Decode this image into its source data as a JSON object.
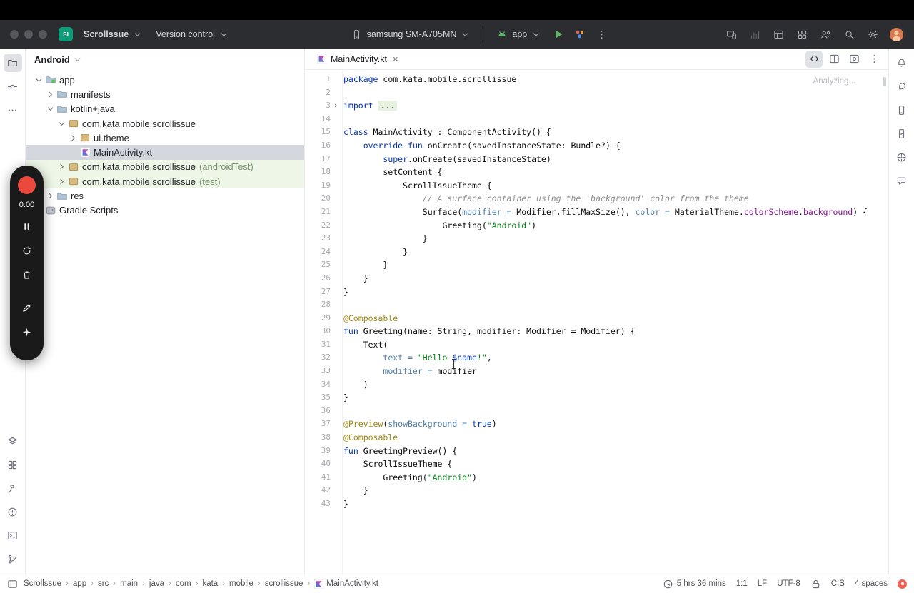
{
  "toolbar": {
    "logo_text": "SI",
    "project_name": "Scrollssue",
    "vcs_label": "Version control",
    "device_label": "samsung SM-A705MN",
    "run_config_label": "app",
    "right_icons": [
      {
        "name": "mirror-device-icon",
        "glyph": "mirror"
      },
      {
        "name": "profiler-icon",
        "glyph": "profiler",
        "dim": true
      },
      {
        "name": "tool-windows-icon",
        "glyph": "toolwin"
      },
      {
        "name": "plugins-icon",
        "glyph": "plugins"
      },
      {
        "name": "code-with-me-icon",
        "glyph": "cwm"
      },
      {
        "name": "search-icon",
        "glyph": "search"
      },
      {
        "name": "settings-icon",
        "glyph": "gear"
      },
      {
        "name": "user-avatar",
        "glyph": "avatar"
      }
    ]
  },
  "left_stripe": {
    "top": [
      {
        "name": "project-icon",
        "glyph": "folder",
        "active": true
      },
      {
        "name": "commit-icon",
        "glyph": "commit"
      },
      {
        "name": "more-tool-windows-icon",
        "glyph": "dots"
      }
    ],
    "bottom": [
      {
        "name": "build-variants-icon",
        "glyph": "layers"
      },
      {
        "name": "resource-manager-icon",
        "glyph": "plugins"
      },
      {
        "name": "build-icon",
        "glyph": "build"
      },
      {
        "name": "problems-icon",
        "glyph": "alert"
      },
      {
        "name": "terminal-icon",
        "glyph": "terminal"
      },
      {
        "name": "version-control-icon",
        "glyph": "branch"
      }
    ]
  },
  "right_stripe": {
    "top": [
      {
        "name": "notifications-icon",
        "glyph": "bell"
      },
      {
        "name": "gradle-icon",
        "glyph": "gradle"
      },
      {
        "name": "device-manager-icon",
        "glyph": "phone"
      },
      {
        "name": "running-devices-icon",
        "glyph": "device2"
      },
      {
        "name": "app-quality-insights-icon",
        "glyph": "insights"
      },
      {
        "name": "assistant-icon",
        "glyph": "assistant"
      }
    ]
  },
  "project": {
    "view_selector": "Android",
    "tree": [
      {
        "label": "app",
        "depth": 0,
        "chevron": "open",
        "icon": "module"
      },
      {
        "label": "manifests",
        "depth": 1,
        "chevron": "closed",
        "icon": "folder"
      },
      {
        "label": "kotlin+java",
        "depth": 1,
        "chevron": "open",
        "icon": "folder"
      },
      {
        "label": "com.kata.mobile.scrollissue",
        "depth": 2,
        "chevron": "open",
        "icon": "package"
      },
      {
        "label": "ui.theme",
        "depth": 3,
        "chevron": "closed",
        "icon": "package"
      },
      {
        "label": "MainActivity.kt",
        "depth": 3,
        "chevron": null,
        "icon": "kotlin",
        "state": "selected"
      },
      {
        "label": "com.kata.mobile.scrollissue",
        "suffix": "(androidTest)",
        "depth": 2,
        "chevron": "closed",
        "icon": "package",
        "state": "green"
      },
      {
        "label": "com.kata.mobile.scrollissue",
        "suffix": "(test)",
        "depth": 2,
        "chevron": "closed",
        "icon": "package",
        "state": "green"
      },
      {
        "label": "res",
        "depth": 1,
        "chevron": "closed",
        "icon": "folder"
      },
      {
        "label": "Gradle Scripts",
        "depth": 0,
        "chevron": "closed",
        "icon": "gradle"
      }
    ]
  },
  "editor": {
    "tab_label": "MainActivity.kt",
    "analyzing": "Analyzing...",
    "mode_icons": [
      {
        "name": "editor-mode-code-icon",
        "glyph": "codeview",
        "active": true
      },
      {
        "name": "editor-mode-split-icon",
        "glyph": "splitview"
      },
      {
        "name": "editor-mode-design-icon",
        "glyph": "designview"
      }
    ],
    "lines": [
      {
        "n": 1,
        "s": [
          [
            "kw",
            "package "
          ],
          [
            "p",
            "com.kata.mobile.scrollissue"
          ]
        ]
      },
      {
        "n": 2,
        "s": []
      },
      {
        "n": 3,
        "fold": true,
        "s": [
          [
            "kw",
            "import "
          ],
          [
            "fold",
            "..."
          ]
        ]
      },
      {
        "n": 14,
        "s": []
      },
      {
        "n": 15,
        "s": [
          [
            "kw",
            "class "
          ],
          [
            "p",
            "MainActivity : ComponentActivity() {"
          ]
        ]
      },
      {
        "n": 16,
        "s": [
          [
            "p",
            "    "
          ],
          [
            "kw",
            "override fun "
          ],
          [
            "p",
            "onCreate(savedInstanceState: Bundle?) {"
          ]
        ]
      },
      {
        "n": 17,
        "s": [
          [
            "p",
            "        "
          ],
          [
            "kw",
            "super"
          ],
          [
            "p",
            ".onCreate(savedInstanceState)"
          ]
        ]
      },
      {
        "n": 18,
        "s": [
          [
            "p",
            "        setContent {"
          ]
        ]
      },
      {
        "n": 19,
        "s": [
          [
            "p",
            "            ScrollIssueTheme {"
          ]
        ]
      },
      {
        "n": 20,
        "s": [
          [
            "p",
            "                "
          ],
          [
            "cm",
            "// A surface container using the 'background' color from the theme"
          ]
        ]
      },
      {
        "n": 21,
        "s": [
          [
            "p",
            "                Surface("
          ],
          [
            "na",
            "modifier = "
          ],
          [
            "p",
            "Modifier.fillMaxSize(), "
          ],
          [
            "na",
            "color = "
          ],
          [
            "p",
            "MaterialTheme."
          ],
          [
            "pr",
            "colorScheme"
          ],
          [
            "p",
            "."
          ],
          [
            "pr",
            "background"
          ],
          [
            "p",
            ") {"
          ]
        ]
      },
      {
        "n": 22,
        "s": [
          [
            "p",
            "                    Greeting("
          ],
          [
            "str",
            "\"Android\""
          ],
          [
            "p",
            ")"
          ]
        ]
      },
      {
        "n": 23,
        "s": [
          [
            "p",
            "                }"
          ]
        ]
      },
      {
        "n": 24,
        "s": [
          [
            "p",
            "            }"
          ]
        ]
      },
      {
        "n": 25,
        "s": [
          [
            "p",
            "        }"
          ]
        ]
      },
      {
        "n": 26,
        "s": [
          [
            "p",
            "    }"
          ]
        ]
      },
      {
        "n": 27,
        "s": [
          [
            "p",
            "}"
          ]
        ]
      },
      {
        "n": 28,
        "s": []
      },
      {
        "n": 29,
        "s": [
          [
            "ann",
            "@Composable"
          ]
        ]
      },
      {
        "n": 30,
        "s": [
          [
            "kw",
            "fun "
          ],
          [
            "p",
            "Greeting(name: String, modifier: Modifier = Modifier) {"
          ]
        ]
      },
      {
        "n": 31,
        "s": [
          [
            "p",
            "    Text("
          ]
        ]
      },
      {
        "n": 32,
        "s": [
          [
            "p",
            "        "
          ],
          [
            "na",
            "text = "
          ],
          [
            "str",
            "\"Hello "
          ],
          [
            "kw",
            "$name"
          ],
          [
            "str",
            "!\""
          ],
          [
            "p",
            ","
          ]
        ]
      },
      {
        "n": 33,
        "s": [
          [
            "p",
            "        "
          ],
          [
            "na",
            "modifier = "
          ],
          [
            "p",
            "modifier"
          ]
        ]
      },
      {
        "n": 34,
        "s": [
          [
            "p",
            "    )"
          ]
        ]
      },
      {
        "n": 35,
        "s": [
          [
            "p",
            "}"
          ]
        ]
      },
      {
        "n": 36,
        "s": []
      },
      {
        "n": 37,
        "s": [
          [
            "ann",
            "@Preview"
          ],
          [
            "p",
            "("
          ],
          [
            "na",
            "showBackground = "
          ],
          [
            "kw",
            "true"
          ],
          [
            "p",
            ")"
          ]
        ]
      },
      {
        "n": 38,
        "s": [
          [
            "ann",
            "@Composable"
          ]
        ]
      },
      {
        "n": 39,
        "s": [
          [
            "kw",
            "fun "
          ],
          [
            "p",
            "GreetingPreview() {"
          ]
        ]
      },
      {
        "n": 40,
        "s": [
          [
            "p",
            "    ScrollIssueTheme {"
          ]
        ]
      },
      {
        "n": 41,
        "s": [
          [
            "p",
            "        Greeting("
          ],
          [
            "str",
            "\"Android\""
          ],
          [
            "p",
            ")"
          ]
        ]
      },
      {
        "n": 42,
        "s": [
          [
            "p",
            "    }"
          ]
        ]
      },
      {
        "n": 43,
        "s": [
          [
            "p",
            "}"
          ]
        ]
      }
    ]
  },
  "record_widget": {
    "time": "0:00",
    "buttons": [
      {
        "name": "pause-button",
        "glyph": "pause"
      },
      {
        "name": "restart-button",
        "glyph": "restart"
      },
      {
        "name": "delete-button",
        "glyph": "trash"
      },
      {
        "name": "annotate-button",
        "glyph": "pencil",
        "gap": true
      },
      {
        "name": "ai-actions-button",
        "glyph": "sparkle"
      }
    ]
  },
  "statusbar": {
    "breadcrumbs": [
      {
        "label": "Scrollssue"
      },
      {
        "label": "app"
      },
      {
        "label": "src"
      },
      {
        "label": "main"
      },
      {
        "label": "java"
      },
      {
        "label": "com"
      },
      {
        "label": "kata"
      },
      {
        "label": "mobile"
      },
      {
        "label": "scrollissue"
      },
      {
        "label": "MainActivity.kt",
        "icon": "kotlin"
      }
    ],
    "right_items": [
      {
        "name": "session-timer",
        "icon": "clock",
        "label": "5 hrs 36 mins"
      },
      {
        "name": "cursor-position",
        "label": "1:1"
      },
      {
        "name": "line-separator",
        "label": "LF"
      },
      {
        "name": "file-encoding",
        "label": "UTF-8"
      },
      {
        "name": "read-only-toggle",
        "icon": "lock",
        "label": ""
      },
      {
        "name": "column-selection-mode",
        "label": "C:S"
      },
      {
        "name": "indent-style",
        "label": "4 spaces"
      },
      {
        "name": "notification-badge",
        "icon": "badge",
        "label": ""
      }
    ]
  }
}
